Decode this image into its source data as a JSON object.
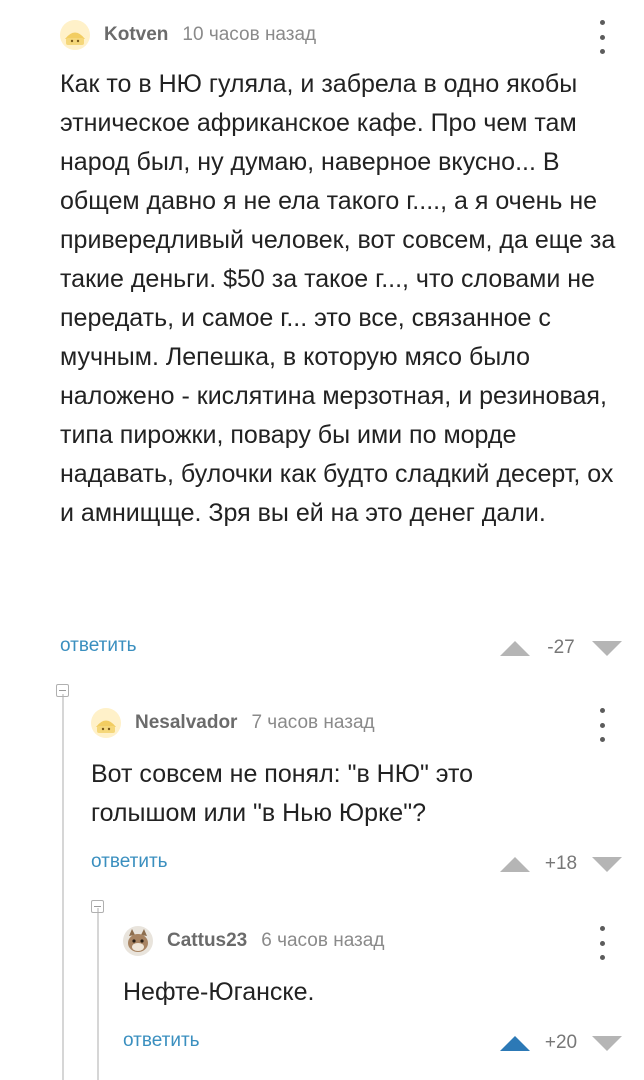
{
  "comments": [
    {
      "username": "Kotven",
      "time": "10 часов назад",
      "text": "Как то в НЮ гуляла, и забрела в одно якобы этническое африканское кафе. Про чем там народ был, ну думаю, наверное вкусно... В  общем давно я не ела такого г...., а я очень не привередливый человек, вот совсем, да еще за такие деньги. $50 за такое г..., что словами не передать, и самое г... это все, связанное с мучным. Лепешка, в которую мясо было наложено - кислятина мерзотная, и резиновая, типа пирожки, повару бы ими по морде надавать, булочки как будто сладкий десерт, ох и амнищще. Зря вы ей на это денег дали.",
      "reply_label": "ответить",
      "rating": "-27"
    },
    {
      "username": "Nesalvador",
      "time": "7 часов назад",
      "text": "Вот совсем не понял: \"в НЮ\" это голышом или \"в Нью Юрке\"?",
      "reply_label": "ответить",
      "rating": "+18"
    },
    {
      "username": "Cattus23",
      "time": "6 часов назад",
      "text": "Нефте-Юганске.",
      "reply_label": "ответить",
      "rating": "+20"
    }
  ],
  "colors": {
    "link": "#3a8fbf",
    "vote_active": "#2c79b6",
    "vote_inactive": "#b5b5b5"
  },
  "icons": {
    "avatar_default": "smiling-face-avatar",
    "avatar_cat": "cat-avatar",
    "more": "vertical-dots-icon",
    "collapse": "collapse-minus-icon"
  }
}
